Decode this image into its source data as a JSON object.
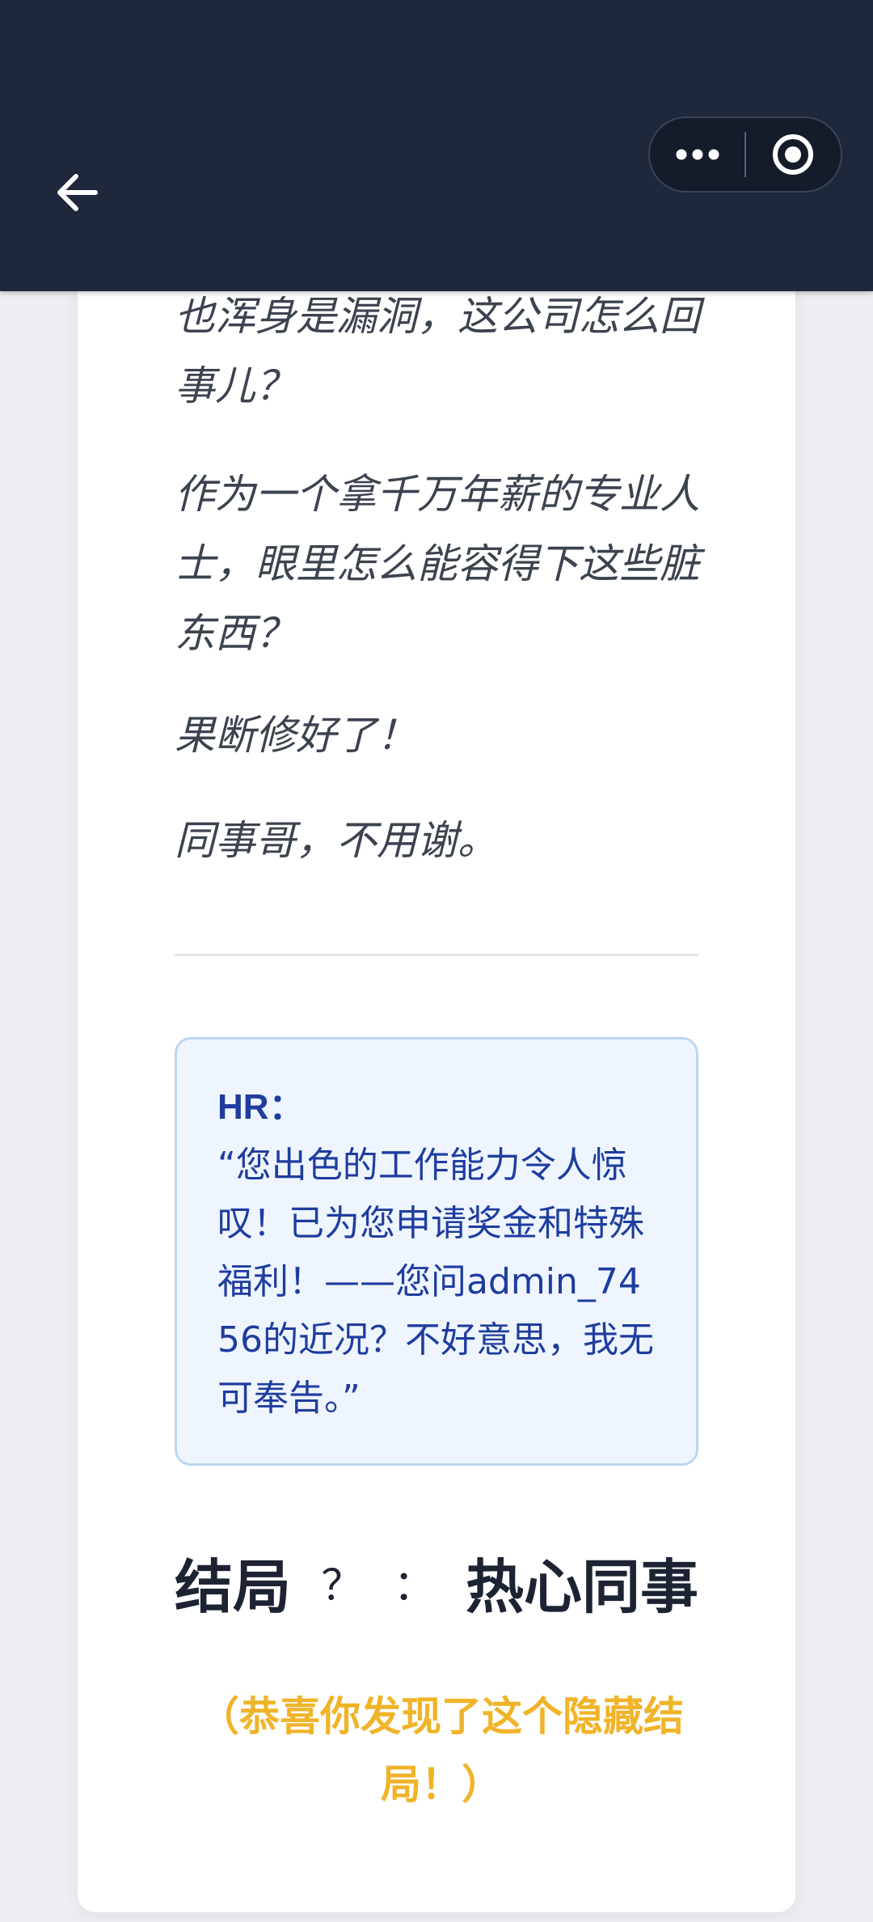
{
  "nav": {
    "back_icon": "arrow-left-icon",
    "more_icon": "more-dots-icon",
    "close_icon": "target-circle-icon"
  },
  "story": {
    "paragraphs": [
      "也浑身是漏洞，这公司怎么回事儿？",
      "作为一个拿千万年薪的专业人士，眼里怎么能容得下这些脏东西？",
      "果断修好了！",
      "同事哥，不用谢。"
    ]
  },
  "hr_message": {
    "speaker": "HR：",
    "quote": "“您出色的工作能力令人惊叹！已为您申请奖金和特殊福利！——您问admin_7456的近况？不好意思，我无可奉告。”"
  },
  "ending": {
    "label": "结局",
    "number": "？",
    "separator": "：",
    "title": "热心同事",
    "congrats": "（恭喜你发现了这个隐藏结局！）"
  },
  "colors": {
    "topbar": "#1f283a",
    "hr_text": "#1f3d9e",
    "hr_bg": "#eef5ff",
    "congrats": "#f0b429"
  }
}
